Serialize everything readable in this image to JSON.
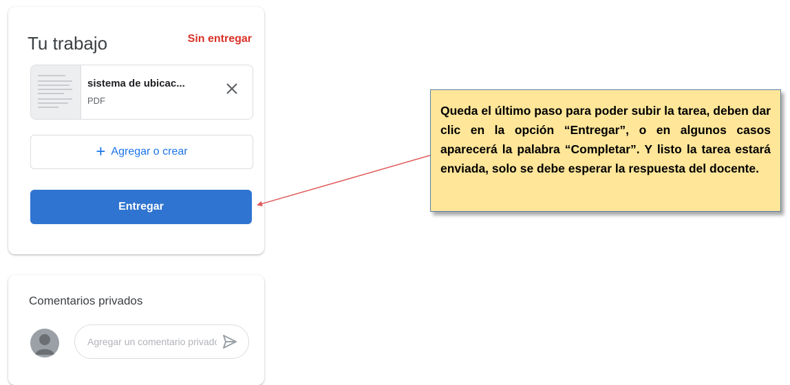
{
  "work": {
    "title": "Tu trabajo",
    "status": "Sin entregar",
    "status_color": "#d93025",
    "attachment": {
      "name": "sistema de ubicac...",
      "type": "PDF",
      "remove_icon": "close-icon"
    },
    "add_label": "Agregar o crear",
    "add_icon": "plus-icon",
    "submit_label": "Entregar",
    "submit_color": "#2f74d0"
  },
  "comments": {
    "title": "Comentarios privados",
    "placeholder": "Agregar un comentario privado",
    "send_icon": "send-icon",
    "avatar_icon": "avatar-icon"
  },
  "callout": {
    "text": "Queda el último paso para poder subir la tarea, deben dar clic en la opción “Entregar”, o en algunos casos aparecerá la palabra “Completar”. Y listo la tarea estará enviada, solo se debe esperar la respuesta del docente.",
    "background": "#ffe699",
    "arrow_color": "#e05a5a"
  }
}
